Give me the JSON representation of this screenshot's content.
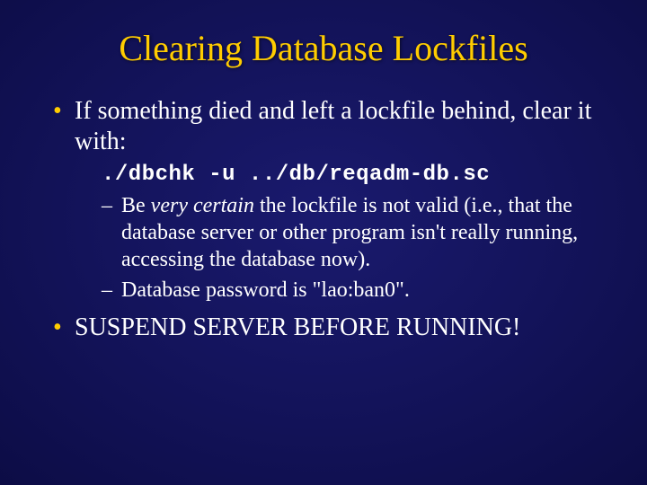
{
  "title": "Clearing Database Lockfiles",
  "bullet1": "If something died and left a lockfile behind, clear it with:",
  "cmd": "./dbchk -u ../db/reqadm-db.sc",
  "sub1a": "Be ",
  "sub1b": "very certain",
  "sub1c": " the lockfile is not valid (i.e., that the database server or other program isn't really running, accessing the database now).",
  "sub2": "Database password is \"lao:ban0\".",
  "bullet2": "SUSPEND SERVER BEFORE RUNNING!"
}
